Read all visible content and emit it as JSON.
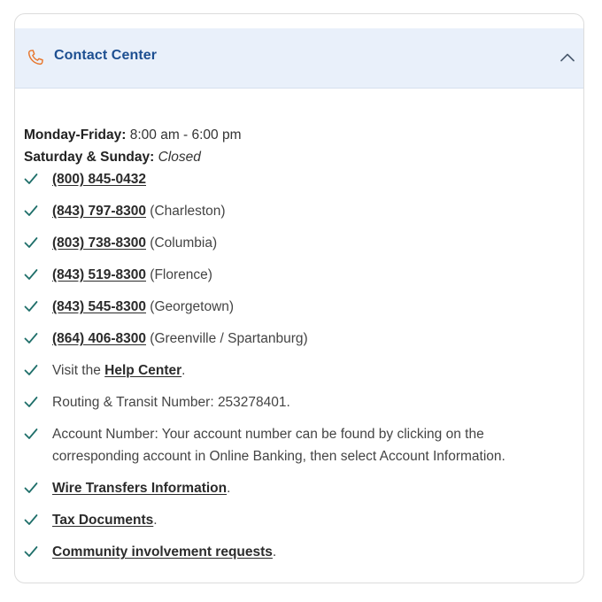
{
  "header": {
    "title": "Contact Center",
    "icon": "phone-icon",
    "toggle_icon": "chevron-up-icon",
    "accent_color": "#1d4f91",
    "icon_color": "#e8772e"
  },
  "hours": {
    "weekday_label": "Monday-Friday:",
    "weekday_value": "8:00 am - 6:00 pm",
    "weekend_label": "Saturday & Sunday:",
    "weekend_value": "Closed"
  },
  "check_color": "#1f6f6a",
  "items": [
    {
      "link": "(800) 845-0432",
      "suffix": ""
    },
    {
      "link": "(843) 797-8300",
      "suffix": " (Charleston)"
    },
    {
      "link": "(803) 738-8300",
      "suffix": " (Columbia)"
    },
    {
      "link": "(843) 519-8300",
      "suffix": " (Florence)"
    },
    {
      "link": "(843) 545-8300",
      "suffix": " (Georgetown)"
    },
    {
      "link": "(864) 406-8300",
      "suffix": " (Greenville / Spartanburg)"
    },
    {
      "prefix": "Visit the ",
      "link": "Help Center",
      "suffix": "."
    },
    {
      "text": "Routing & Transit Number: 253278401."
    },
    {
      "text": "Account Number: Your account number can be found by clicking on the corresponding account in Online Banking, then select Account Information."
    },
    {
      "link": "Wire Transfers Information",
      "suffix": "."
    },
    {
      "link": "Tax Documents",
      "suffix": "."
    },
    {
      "link": "Community involvement requests",
      "suffix": "."
    }
  ]
}
